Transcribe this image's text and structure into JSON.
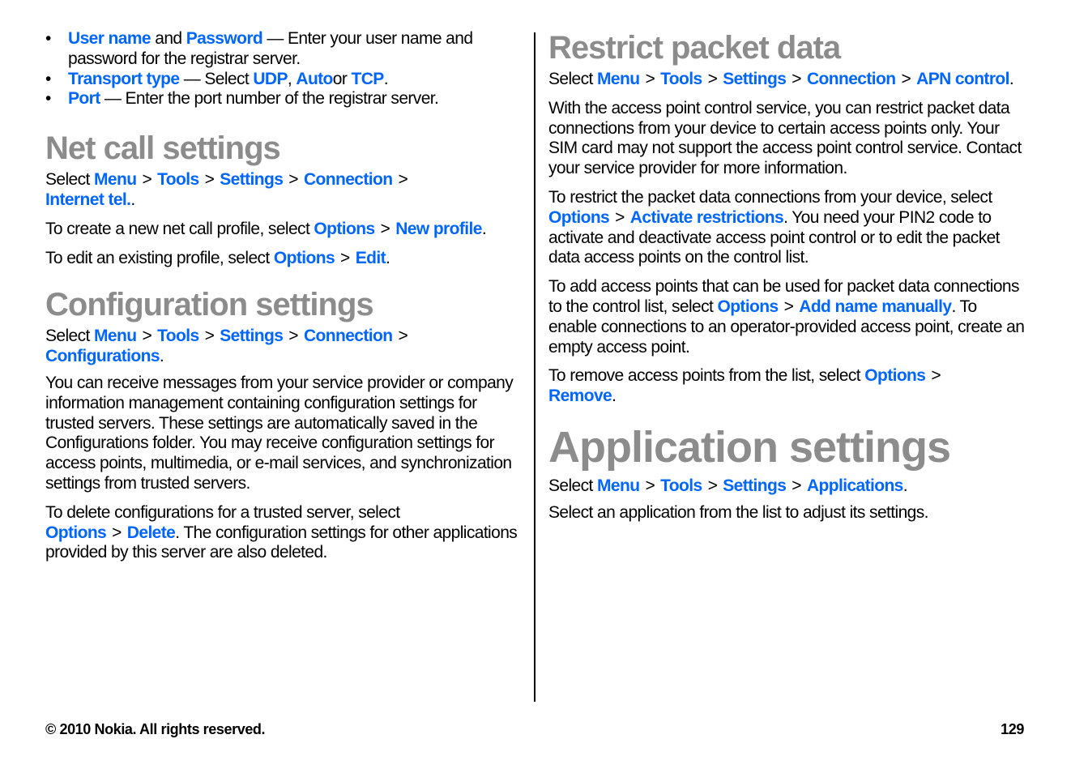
{
  "colors": {
    "link": "#0066ff",
    "heading": "#8c8c8c",
    "text": "#000000"
  },
  "left": {
    "bullets": [
      {
        "a": "User name",
        "b": " and ",
        "c": "Password",
        "d": " — Enter your user name and password for the registrar server."
      },
      {
        "a": "Transport type",
        "b": "  — Select ",
        "c": "UDP",
        "d": ", ",
        "e": "Auto",
        "f": "or ",
        "g": "TCP",
        "h": "."
      },
      {
        "a": "Port",
        "b": "  — Enter the port number of the registrar server."
      }
    ],
    "net_call": {
      "title": "Net call settings",
      "path_prefix": "Select ",
      "path": [
        "Menu",
        "Tools",
        "Settings",
        "Connection",
        "Internet tel."
      ],
      "path_suffix": ".",
      "create_text": "To create a new net call profile, select ",
      "create_links": [
        "Options",
        "New profile"
      ],
      "edit_text": "To edit an existing profile, select ",
      "edit_links": [
        "Options",
        "Edit"
      ],
      "period": "."
    },
    "config": {
      "title": "Configuration settings",
      "path_prefix": "Select ",
      "path": [
        "Menu",
        "Tools",
        "Settings",
        "Connection",
        "Configurations"
      ],
      "path_suffix": ".",
      "para1": "You can receive messages from your service provider or company information management containing configuration settings for trusted servers. These settings are automatically saved in the Configurations folder. You may receive configuration settings for access points, multimedia, or e-mail services, and synchronization settings from trusted servers.",
      "delete_text": "To delete configurations for a trusted server, select ",
      "delete_links": [
        "Options",
        "Delete"
      ],
      "delete_tail": ". The configuration settings for other applications provided by this server are also deleted."
    }
  },
  "right": {
    "restrict": {
      "title": "Restrict packet data",
      "path_prefix": "Select ",
      "path": [
        "Menu",
        "Tools",
        "Settings",
        "Connection",
        "APN control"
      ],
      "path_suffix": ".",
      "para1": "With the access point control service, you can restrict packet data connections from your device to certain access points only. Your SIM card may not support the access point control service. Contact your service provider for more information.",
      "para2_text": "To restrict the packet data connections from your device, select ",
      "para2_links": [
        "Options",
        "Activate restrictions"
      ],
      "para2_tail": ". You need your PIN2 code to activate and deactivate access point control or to edit the packet data access points on the control list.",
      "para3_text": "To add access points that can be used for packet data connections to the control list, select ",
      "para3_links": [
        "Options",
        "Add name manually"
      ],
      "para3_tail": ". To enable connections to an operator-provided access point, create an empty access point.",
      "para4_text": "To remove access points from the list, select ",
      "para4_links": [
        "Options",
        "Remove"
      ],
      "period": "."
    },
    "apps": {
      "title": "Application settings",
      "path_prefix": "Select ",
      "path": [
        "Menu",
        "Tools",
        "Settings",
        "Applications"
      ],
      "path_suffix": ".",
      "para1": "Select an application from the list to adjust its settings."
    }
  },
  "separator": ">",
  "footer": {
    "copyright": "© 2010 Nokia. All rights reserved.",
    "page_number": "129"
  }
}
